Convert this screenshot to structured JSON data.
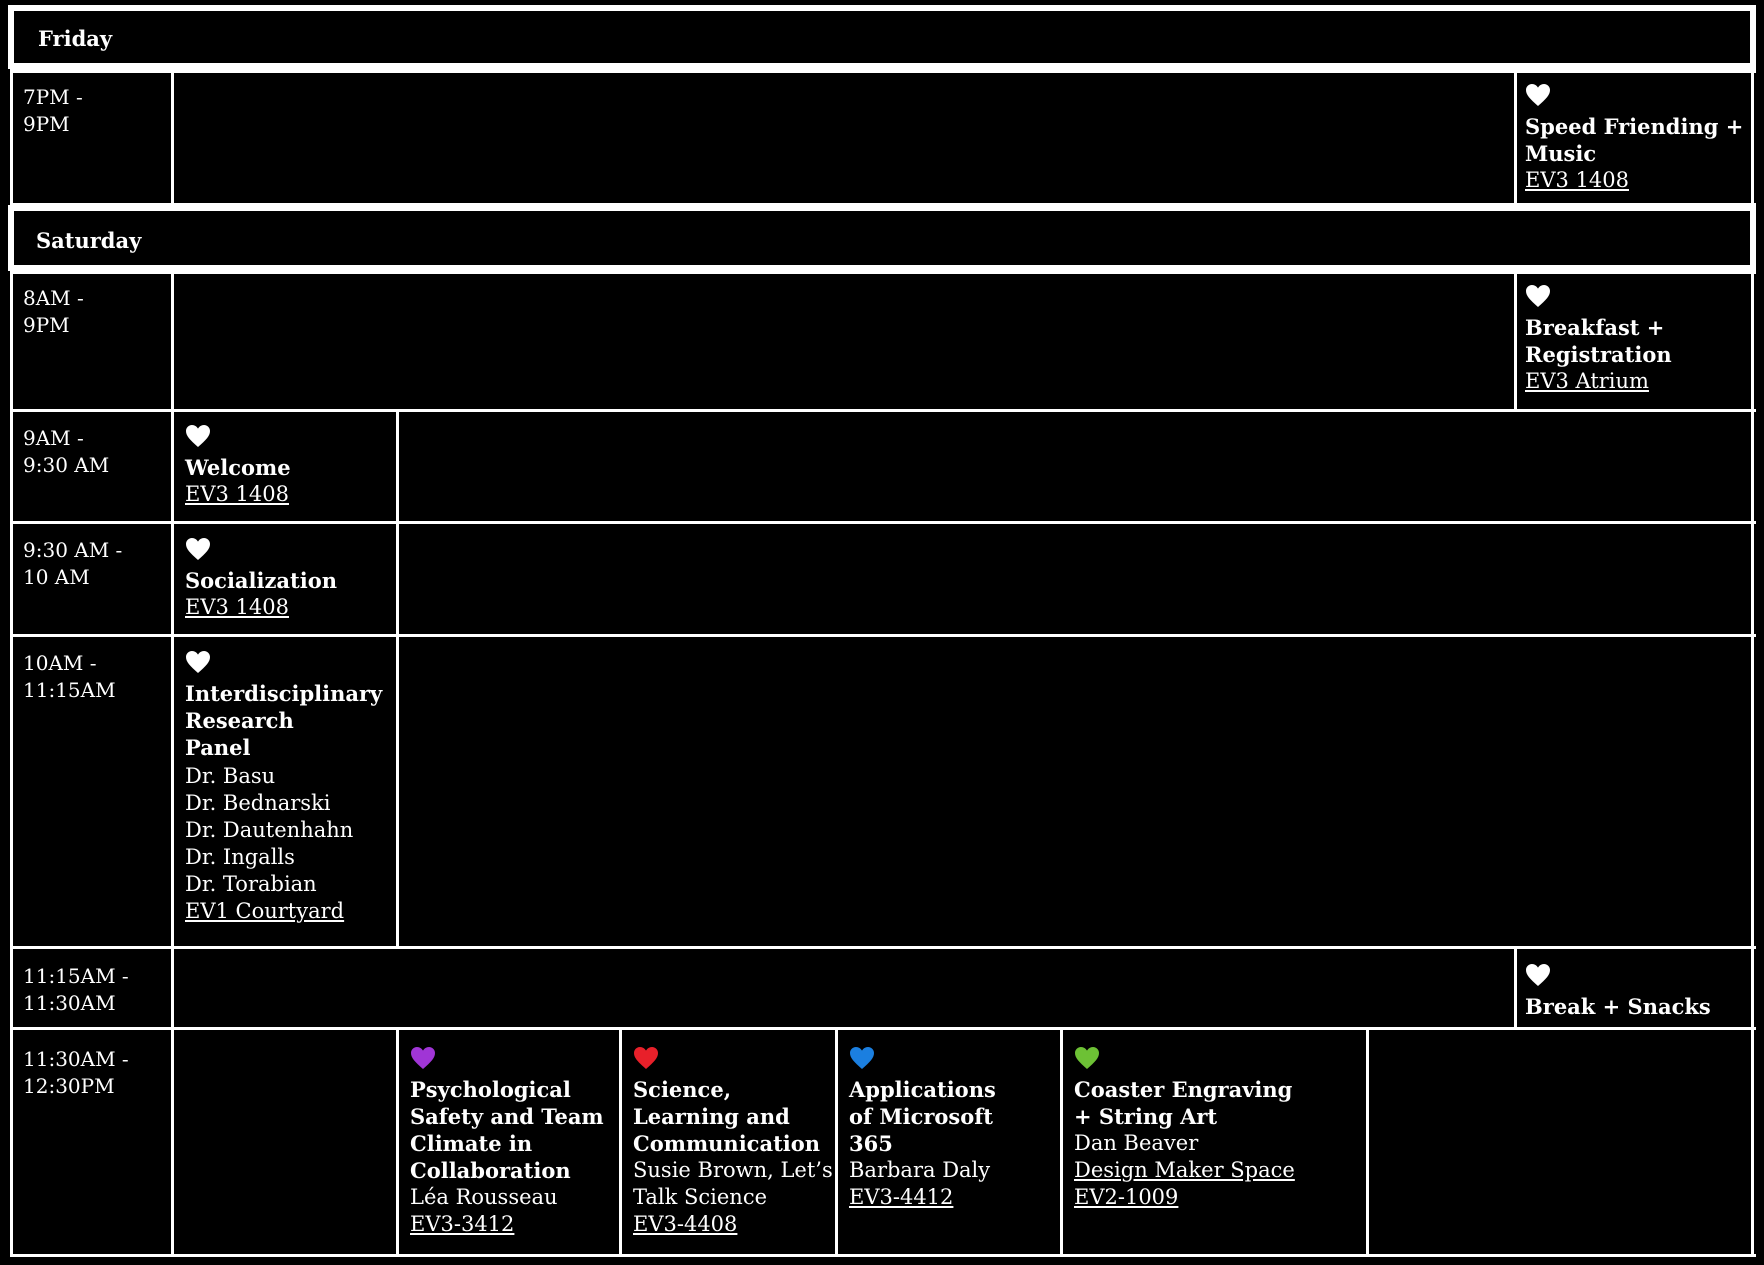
{
  "days": [
    {
      "label": "Friday"
    },
    {
      "label": "Saturday"
    }
  ],
  "colors": {
    "white_heart": "#ffffff",
    "purple_heart": "#a035d6",
    "red_heart": "#e8202a",
    "blue_heart": "#1b7fe0",
    "green_heart": "#6dc135"
  },
  "rows": {
    "fri_7pm": {
      "time": [
        "7PM -",
        "9PM"
      ],
      "event": {
        "icon": "white-heart-icon",
        "title": [
          "Speed Friending +",
          "Music"
        ],
        "location": "EV3 1408"
      }
    },
    "sat_8am": {
      "time": [
        "8AM -",
        "9PM"
      ],
      "event": {
        "icon": "white-heart-icon",
        "title": [
          "Breakfast +",
          "Registration"
        ],
        "location": "EV3 Atrium"
      }
    },
    "sat_9am": {
      "time": [
        "9AM -",
        "9:30 AM"
      ],
      "event": {
        "icon": "white-heart-icon",
        "title": [
          "Welcome"
        ],
        "location": "EV3 1408"
      }
    },
    "sat_930": {
      "time": [
        "9:30 AM -",
        "10 AM"
      ],
      "event": {
        "icon": "white-heart-icon",
        "title": [
          "Socialization"
        ],
        "location": "EV3 1408"
      }
    },
    "sat_10am": {
      "time": [
        "10AM -",
        "11:15AM"
      ],
      "event": {
        "icon": "white-heart-icon",
        "title": [
          "Interdisciplinary",
          "Research",
          "Panel"
        ],
        "people": [
          "Dr. Basu",
          "Dr. Bednarski",
          "Dr. Dautenhahn",
          "Dr. Ingalls",
          "Dr. Torabian"
        ],
        "location": "EV1 Courtyard"
      }
    },
    "sat_1115": {
      "time": [
        "11:15AM -",
        "11:30AM"
      ],
      "event": {
        "icon": "white-heart-icon",
        "title": [
          "Break + Snacks"
        ]
      }
    },
    "sat_1130": {
      "time": [
        "11:30AM -",
        "12:30PM"
      ],
      "events": [
        {
          "icon": "purple-heart-icon",
          "title": [
            "Psychological",
            "Safety and Team",
            "Climate in",
            "Collaboration"
          ],
          "people": [
            "Léa Rousseau"
          ],
          "location": "EV3-3412"
        },
        {
          "icon": "red-heart-icon",
          "title": [
            "Science,",
            "Learning and",
            "Communication"
          ],
          "people": [
            "Susie Brown, Let’s",
            "Talk Science"
          ],
          "location": "EV3-4408"
        },
        {
          "icon": "blue-heart-icon",
          "title": [
            "Applications",
            "of Microsoft",
            "365"
          ],
          "people": [
            "Barbara Daly"
          ],
          "location": "EV3-4412"
        },
        {
          "icon": "green-heart-icon",
          "title": [
            "Coaster Engraving",
            "+ String Art"
          ],
          "people": [
            "Dan Beaver"
          ],
          "location": "Design Maker Space",
          "location2": "EV2-1009"
        }
      ]
    }
  }
}
